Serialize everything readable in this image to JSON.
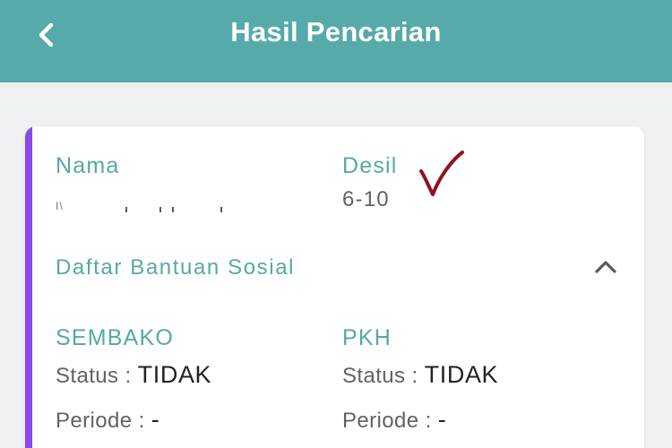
{
  "header": {
    "title": "Hasil Pencarian",
    "background": "#56aaaa",
    "back_icon": "chevron-left-icon"
  },
  "card": {
    "accent_color": "#8b49e6",
    "nama_label": "Nama",
    "nama_value_visible": "I\\",
    "desil_label": "Desil",
    "desil_value": "6-10",
    "annotation_icon": "red-checkmark-icon",
    "section_title": "Daftar Bantuan Sosial",
    "section_toggle_icon": "chevron-up-icon",
    "programs": [
      {
        "name": "SEMBAKO",
        "status_label": "Status :",
        "status_value": "TIDAK",
        "periode_label": "Periode :",
        "periode_value": "-"
      },
      {
        "name": "PKH",
        "status_label": "Status :",
        "status_value": "TIDAK",
        "periode_label": "Periode :",
        "periode_value": "-"
      }
    ]
  },
  "colors": {
    "label_teal": "#56a9a3",
    "value_gray": "#5f6368",
    "checkmark_red": "#8a1520"
  }
}
